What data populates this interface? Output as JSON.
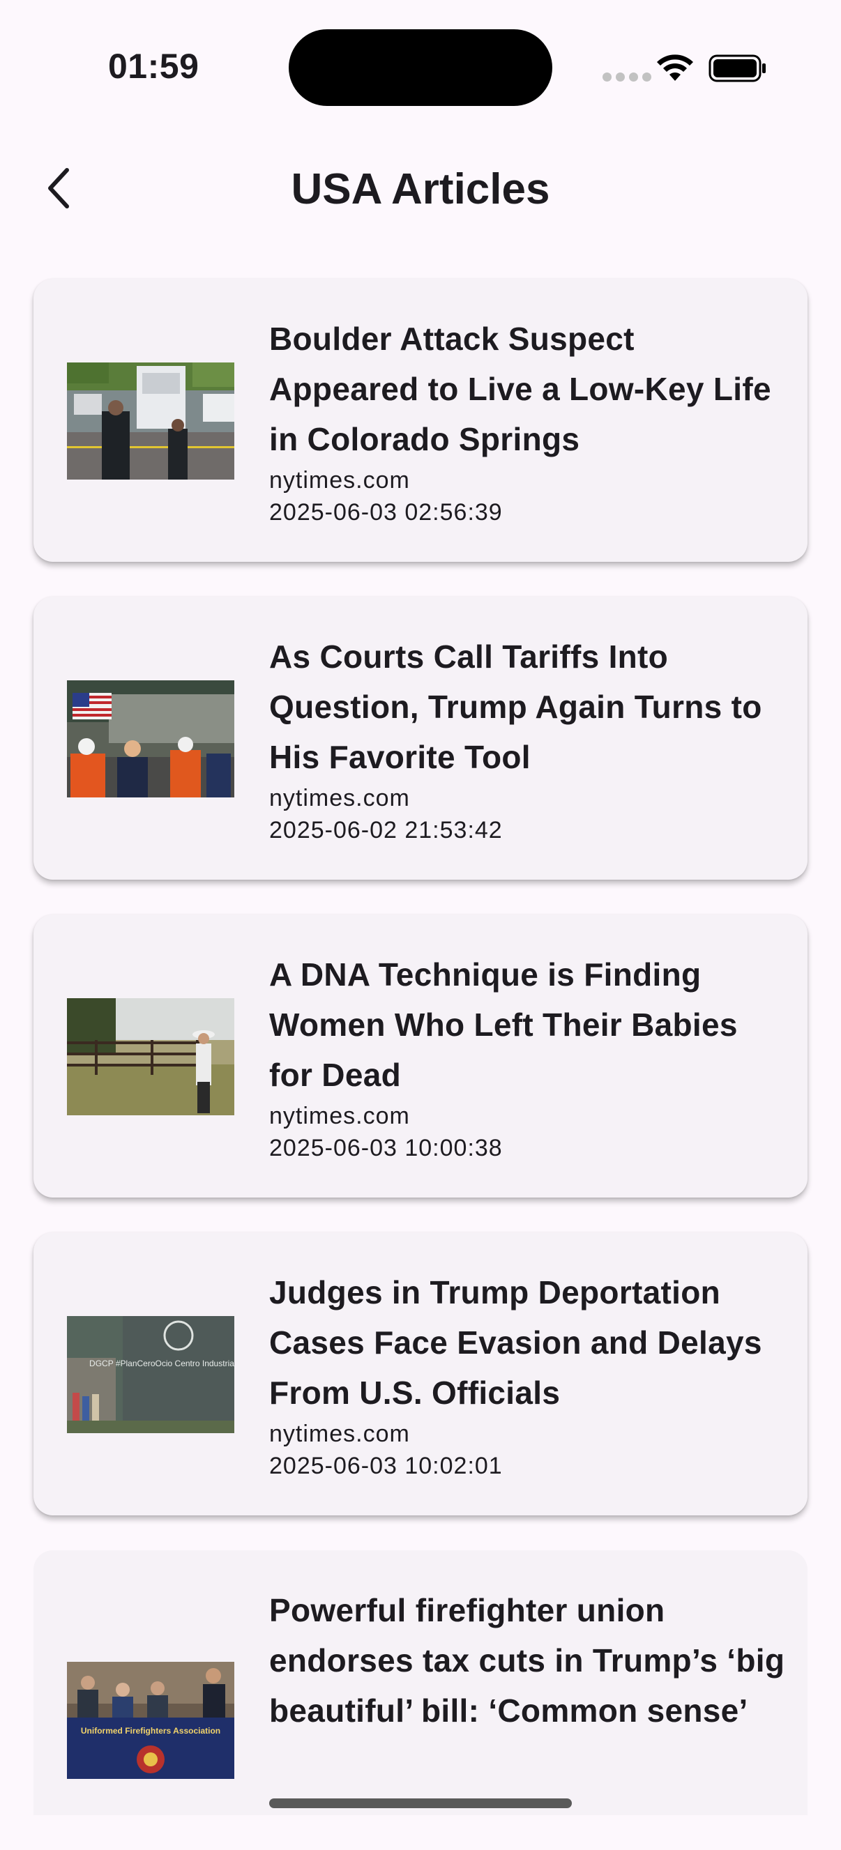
{
  "status_bar": {
    "time": "01:59"
  },
  "header": {
    "title": "USA Articles",
    "back_icon": "chevron-left-icon"
  },
  "articles": [
    {
      "title": "Boulder Attack Suspect Appeared to Live a Low-Key Life in Colorado Springs",
      "source": "nytimes.com",
      "date": "2025-06-03 02:56:39"
    },
    {
      "title": "As Courts Call Tariffs Into Question, Trump Again Turns to His Favorite Tool",
      "source": "nytimes.com",
      "date": "2025-06-02 21:53:42"
    },
    {
      "title": "A DNA Technique is Finding Women Who Left Their Babies for Dead",
      "source": "nytimes.com",
      "date": "2025-06-03 10:00:38"
    },
    {
      "title": "Judges in Trump Deportation Cases Face Evasion and Delays From U.S. Officials",
      "source": "nytimes.com",
      "date": "2025-06-03 10:02:01"
    },
    {
      "title": "Powerful firefighter union endorses tax cuts in Trump’s ‘big beautiful’ bill: ‘Common sense’"
    }
  ],
  "thumbnails": [
    {
      "signage": ""
    },
    {
      "signage": ""
    },
    {
      "signage": ""
    },
    {
      "signage": "DGCP #PlanCeroOcio Centro Industrial Santa A"
    },
    {
      "signage": "Uniformed Firefighters Association"
    }
  ]
}
